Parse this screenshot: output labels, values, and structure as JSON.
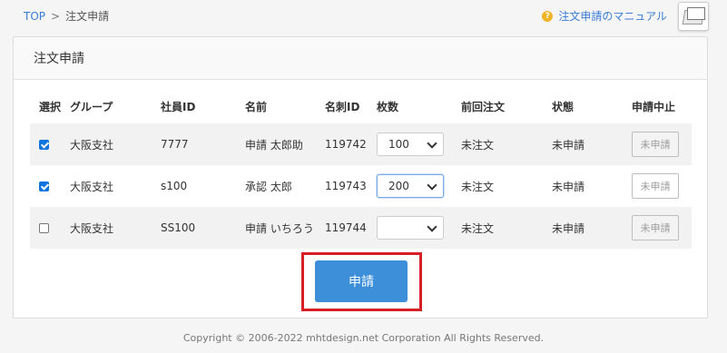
{
  "breadcrumb": {
    "home": "TOP",
    "separator": ">",
    "current": "注文申請"
  },
  "manual": {
    "link": "注文申請のマニュアル",
    "help_glyph": "?"
  },
  "icons": {
    "help": "help-circle-icon",
    "manual": "book-icon"
  },
  "panel": {
    "title": "注文申請"
  },
  "table": {
    "headers": [
      "選択",
      "グループ",
      "社員ID",
      "名前",
      "名刺ID",
      "枚数",
      "前回注文",
      "状態",
      "申請中止"
    ],
    "rows": [
      {
        "checked": true,
        "group": "大阪支社",
        "emp_id": "7777",
        "name": "申請 太郎助",
        "card_id": "119742",
        "qty": "100",
        "last": "未注文",
        "status": "未申請",
        "cancel": "未申請",
        "cancel_enabled": false
      },
      {
        "checked": true,
        "group": "大阪支社",
        "emp_id": "s100",
        "name": "承認 太郎",
        "card_id": "119743",
        "qty": "200",
        "last": "未注文",
        "status": "未申請",
        "cancel": "未申請",
        "cancel_enabled": true
      },
      {
        "checked": false,
        "group": "大阪支社",
        "emp_id": "SS100",
        "name": "申請 いちろう",
        "card_id": "119744",
        "qty": "",
        "last": "未注文",
        "status": "未申請",
        "cancel": "未申請",
        "cancel_enabled": false
      }
    ]
  },
  "submit": {
    "label": "申請"
  },
  "footer": {
    "copyright": "Copyright © 2006-2022 mhtdesign.net Corporation All Rights Reserved."
  },
  "colors": {
    "primary": "#3c8fd8",
    "highlight": "#d71f26",
    "link": "#3a7bd5"
  }
}
